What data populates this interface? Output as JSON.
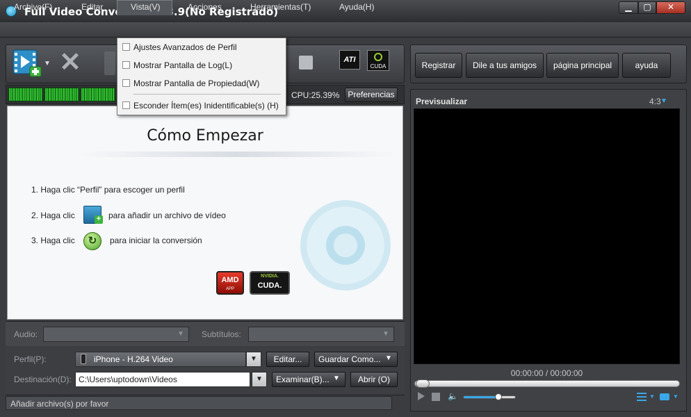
{
  "window": {
    "title": "Full Video Converter 10.3.9(No Registrado)"
  },
  "menubar": [
    "Archivo(F)",
    "Editar",
    "Vista(V)",
    "Acciones",
    "Herramientas(T)",
    "Ayuda(H)"
  ],
  "vista_menu": {
    "items": [
      {
        "label": "Ajustes Avanzados de Perfil",
        "checked": false
      },
      {
        "label": "Mostrar Pantalla de Log(L)",
        "checked": false
      },
      {
        "label": "Mostrar Pantalla de Propiedad(W)",
        "checked": false
      },
      {
        "label": "Esconder Ítem(es) Inidentificable(s) (H)",
        "checked": false
      }
    ]
  },
  "toolbar": {
    "icons": [
      "add-video-icon",
      "delete-icon",
      "stop-icon",
      "ati-stream-icon",
      "nvidia-cuda-icon"
    ],
    "ati_text": "ATI",
    "cuda_text": "CUDA"
  },
  "status_strip": {
    "cpu": "CPU:25.39%",
    "preferences": "Preferencias"
  },
  "howto": {
    "title": "Cómo Empezar",
    "step1": "1. Haga clic “Perfil” para escoger un perfil",
    "step2_prefix": "2. Haga clic",
    "step2_suffix": "para añadir un archivo de vídeo",
    "step3_prefix": "3. Haga clic",
    "step3_suffix": "para iniciar la conversión",
    "amd": "AMD",
    "amd_sub": "APP",
    "nvidia_top": "NVIDIA.",
    "nvidia_cuda": "CUDA."
  },
  "audio_bar": {
    "audio_label": "Audio:",
    "subtitles_label": "Subtítulos:"
  },
  "profile": {
    "label": "Perfil(P):",
    "value": "iPhone - H.264 Video",
    "edit_button": "Editar...",
    "save_as_button": "Guardar Como..."
  },
  "destination": {
    "label": "Destinación(D):",
    "value": "C:\\Users\\uptodown\\Videos",
    "browse_button": "Examinar(B)...",
    "open_button": "Abrir (O)"
  },
  "status": {
    "text": "Añadir archivo(s) por favor"
  },
  "right_buttons": [
    "Registrar",
    "Dile a tus amigos",
    "página principal",
    "ayuda"
  ],
  "preview": {
    "title": "Previsualizar",
    "aspect": "4:3",
    "time": "00:00:00 / 00:00:00",
    "volume_level": 0.66,
    "seek_position": 0
  },
  "colors": {
    "accent": "#3aa8e8",
    "waveform": "#2fbf2f",
    "close": "#c43b2d"
  }
}
